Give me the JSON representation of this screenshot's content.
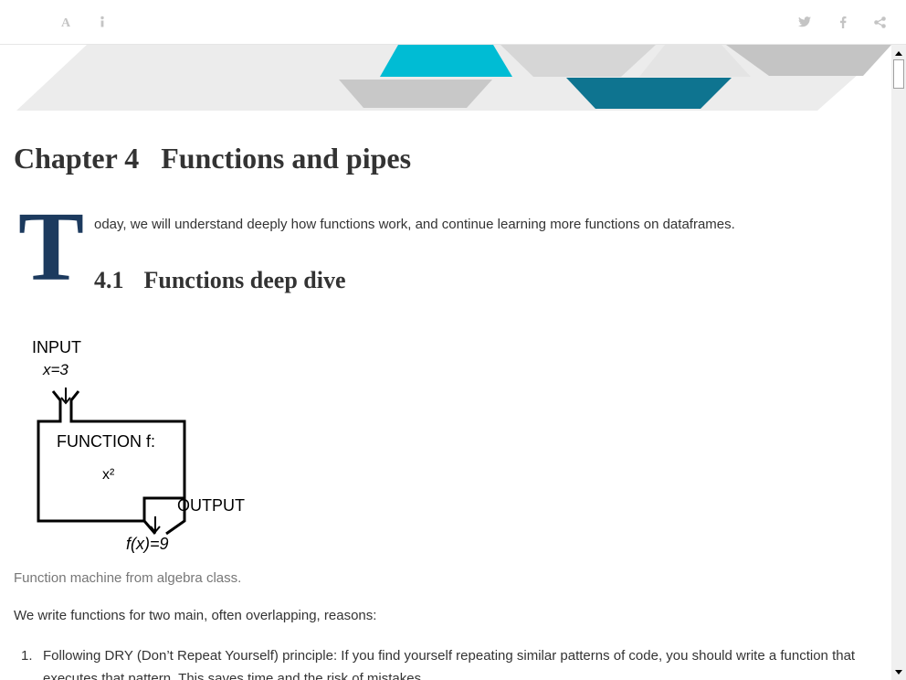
{
  "toolbar": {
    "left_icons": [
      "font-settings-icon",
      "info-icon"
    ],
    "right_icons": [
      "twitter-icon",
      "facebook-icon",
      "share-icon"
    ]
  },
  "colors": {
    "dropcap": "#1c3a5e",
    "banner_cyan": "#00bcd4",
    "banner_teal": "#0e7490",
    "banner_grey": "#c8c8c8",
    "banner_light": "#ececec"
  },
  "chapter": {
    "number": "Chapter 4",
    "title": "Functions and pipes"
  },
  "intro": {
    "dropcap": "T",
    "text": "oday, we will understand deeply how functions work, and continue learning more functions on dataframes."
  },
  "section": {
    "number": "4.1",
    "title": "Functions deep dive"
  },
  "figure": {
    "input_label": "INPUT",
    "input_value": "x=3",
    "function_label": "FUNCTION f:",
    "function_expr": "x²",
    "output_label": "OUTPUT",
    "output_value": "f(x)=9",
    "caption": "Function machine from algebra class."
  },
  "body": {
    "paragraph": "We write functions for two main, often overlapping, reasons:",
    "list": [
      {
        "marker": "1.",
        "text": "Following DRY (Don’t Repeat Yourself) principle: If you find yourself repeating similar patterns of code, you should write a function that executes that pattern. This saves time and the risk of mistakes."
      }
    ]
  }
}
